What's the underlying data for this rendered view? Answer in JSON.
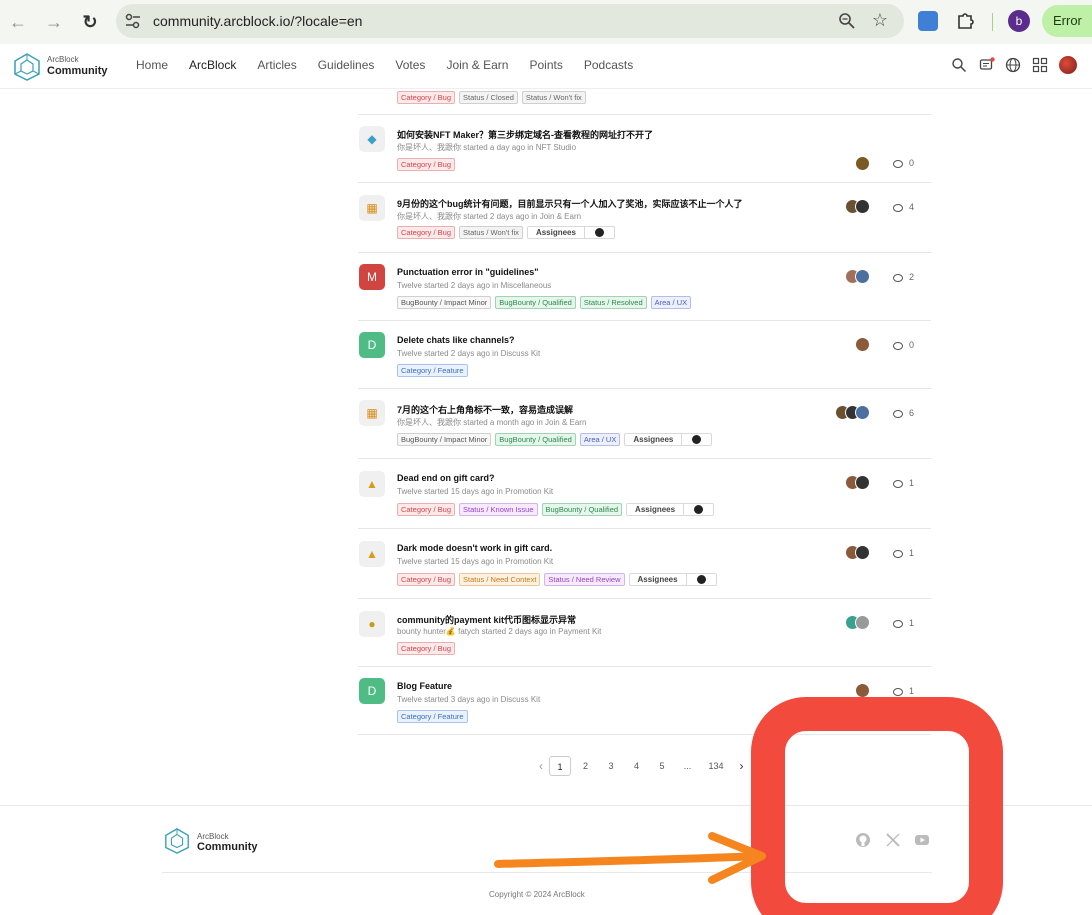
{
  "browser": {
    "url": "community.arcblock.io/?locale=en",
    "profile_initial": "b",
    "error_label": "Error"
  },
  "site": {
    "logo_small": "ArcBlock",
    "logo_big": "Community",
    "menu": [
      "Home",
      "ArcBlock",
      "Articles",
      "Guidelines",
      "Votes",
      "Join & Earn",
      "Points",
      "Podcasts"
    ],
    "active_menu": "ArcBlock"
  },
  "top_tags": [
    "Category / Bug",
    "Status / Closed",
    "Status / Won't fix"
  ],
  "posts": [
    {
      "title": "如何安装NFT Maker？第三步绑定域名-查看教程的网址打不开了",
      "meta": "你是坏人、我跟你 started a day ago in NFT Studio",
      "tags": [
        "Category / Bug"
      ],
      "assignees": false,
      "comments": "0"
    },
    {
      "title": "9月份的这个bug统计有问题，目前显示只有一个人加入了奖池，实际应该不止一个人了",
      "meta": "你是坏人、我跟你 started 2 days ago in Join & Earn",
      "tags": [
        "Category / Bug",
        "Status / Won't fix"
      ],
      "assignees": "Assignees",
      "comments": "4"
    },
    {
      "title": "Punctuation error in \"guidelines\"",
      "badge_letter": "M",
      "meta": "Twelve started 2 days ago in Miscellaneous",
      "tags": [
        "BugBounty / Impact Minor",
        "BugBounty / Qualified",
        "Status / Resolved",
        "Area / UX"
      ],
      "assignees": false,
      "comments": "2"
    },
    {
      "title": "Delete chats like channels?",
      "badge_letter": "D",
      "meta": "Twelve started 2 days ago in Discuss Kit",
      "tags": [
        "Category / Feature"
      ],
      "assignees": false,
      "comments": "0"
    },
    {
      "title": "7月的这个右上角角标不一致，容易造成误解",
      "meta": "你是坏人、我跟你 started a month ago in Join & Earn",
      "tags": [
        "BugBounty / Impact Minor",
        "BugBounty / Qualified",
        "Area / UX"
      ],
      "assignees": "Assignees",
      "comments": "6"
    },
    {
      "title": "Dead end on gift card?",
      "meta": "Twelve started 15 days ago in Promotion Kit",
      "tags": [
        "Category / Bug",
        "Status / Known Issue",
        "BugBounty / Qualified"
      ],
      "assignees": "Assignees",
      "comments": "1"
    },
    {
      "title": "Dark mode doesn't work in gift card.",
      "meta": "Twelve started 15 days ago in Promotion Kit",
      "tags": [
        "Category / Bug",
        "Status / Need Context",
        "Status / Need Review"
      ],
      "assignees": "Assignees",
      "comments": "1"
    },
    {
      "title": "community的payment kit代币图标显示异常",
      "meta": "bounty hunter💰 fatych started 2 days ago in Payment Kit",
      "tags": [
        "Category / Bug"
      ],
      "assignees": false,
      "comments": "1"
    },
    {
      "title": "Blog Feature",
      "badge_letter": "D",
      "meta": "Twelve started 3 days ago in Discuss Kit",
      "tags": [
        "Category / Feature"
      ],
      "assignees": false,
      "comments": "1"
    }
  ],
  "pagination": {
    "pages": [
      "1",
      "2",
      "3",
      "4",
      "5",
      "...",
      "134"
    ],
    "current": "1"
  },
  "footer": {
    "logo_small": "ArcBlock",
    "logo_big": "Community",
    "copyright": "Copyright © 2024 ArcBlock"
  },
  "colors": {
    "annotation_box": "#f24a3c",
    "annotation_arrow": "#f5861f"
  }
}
